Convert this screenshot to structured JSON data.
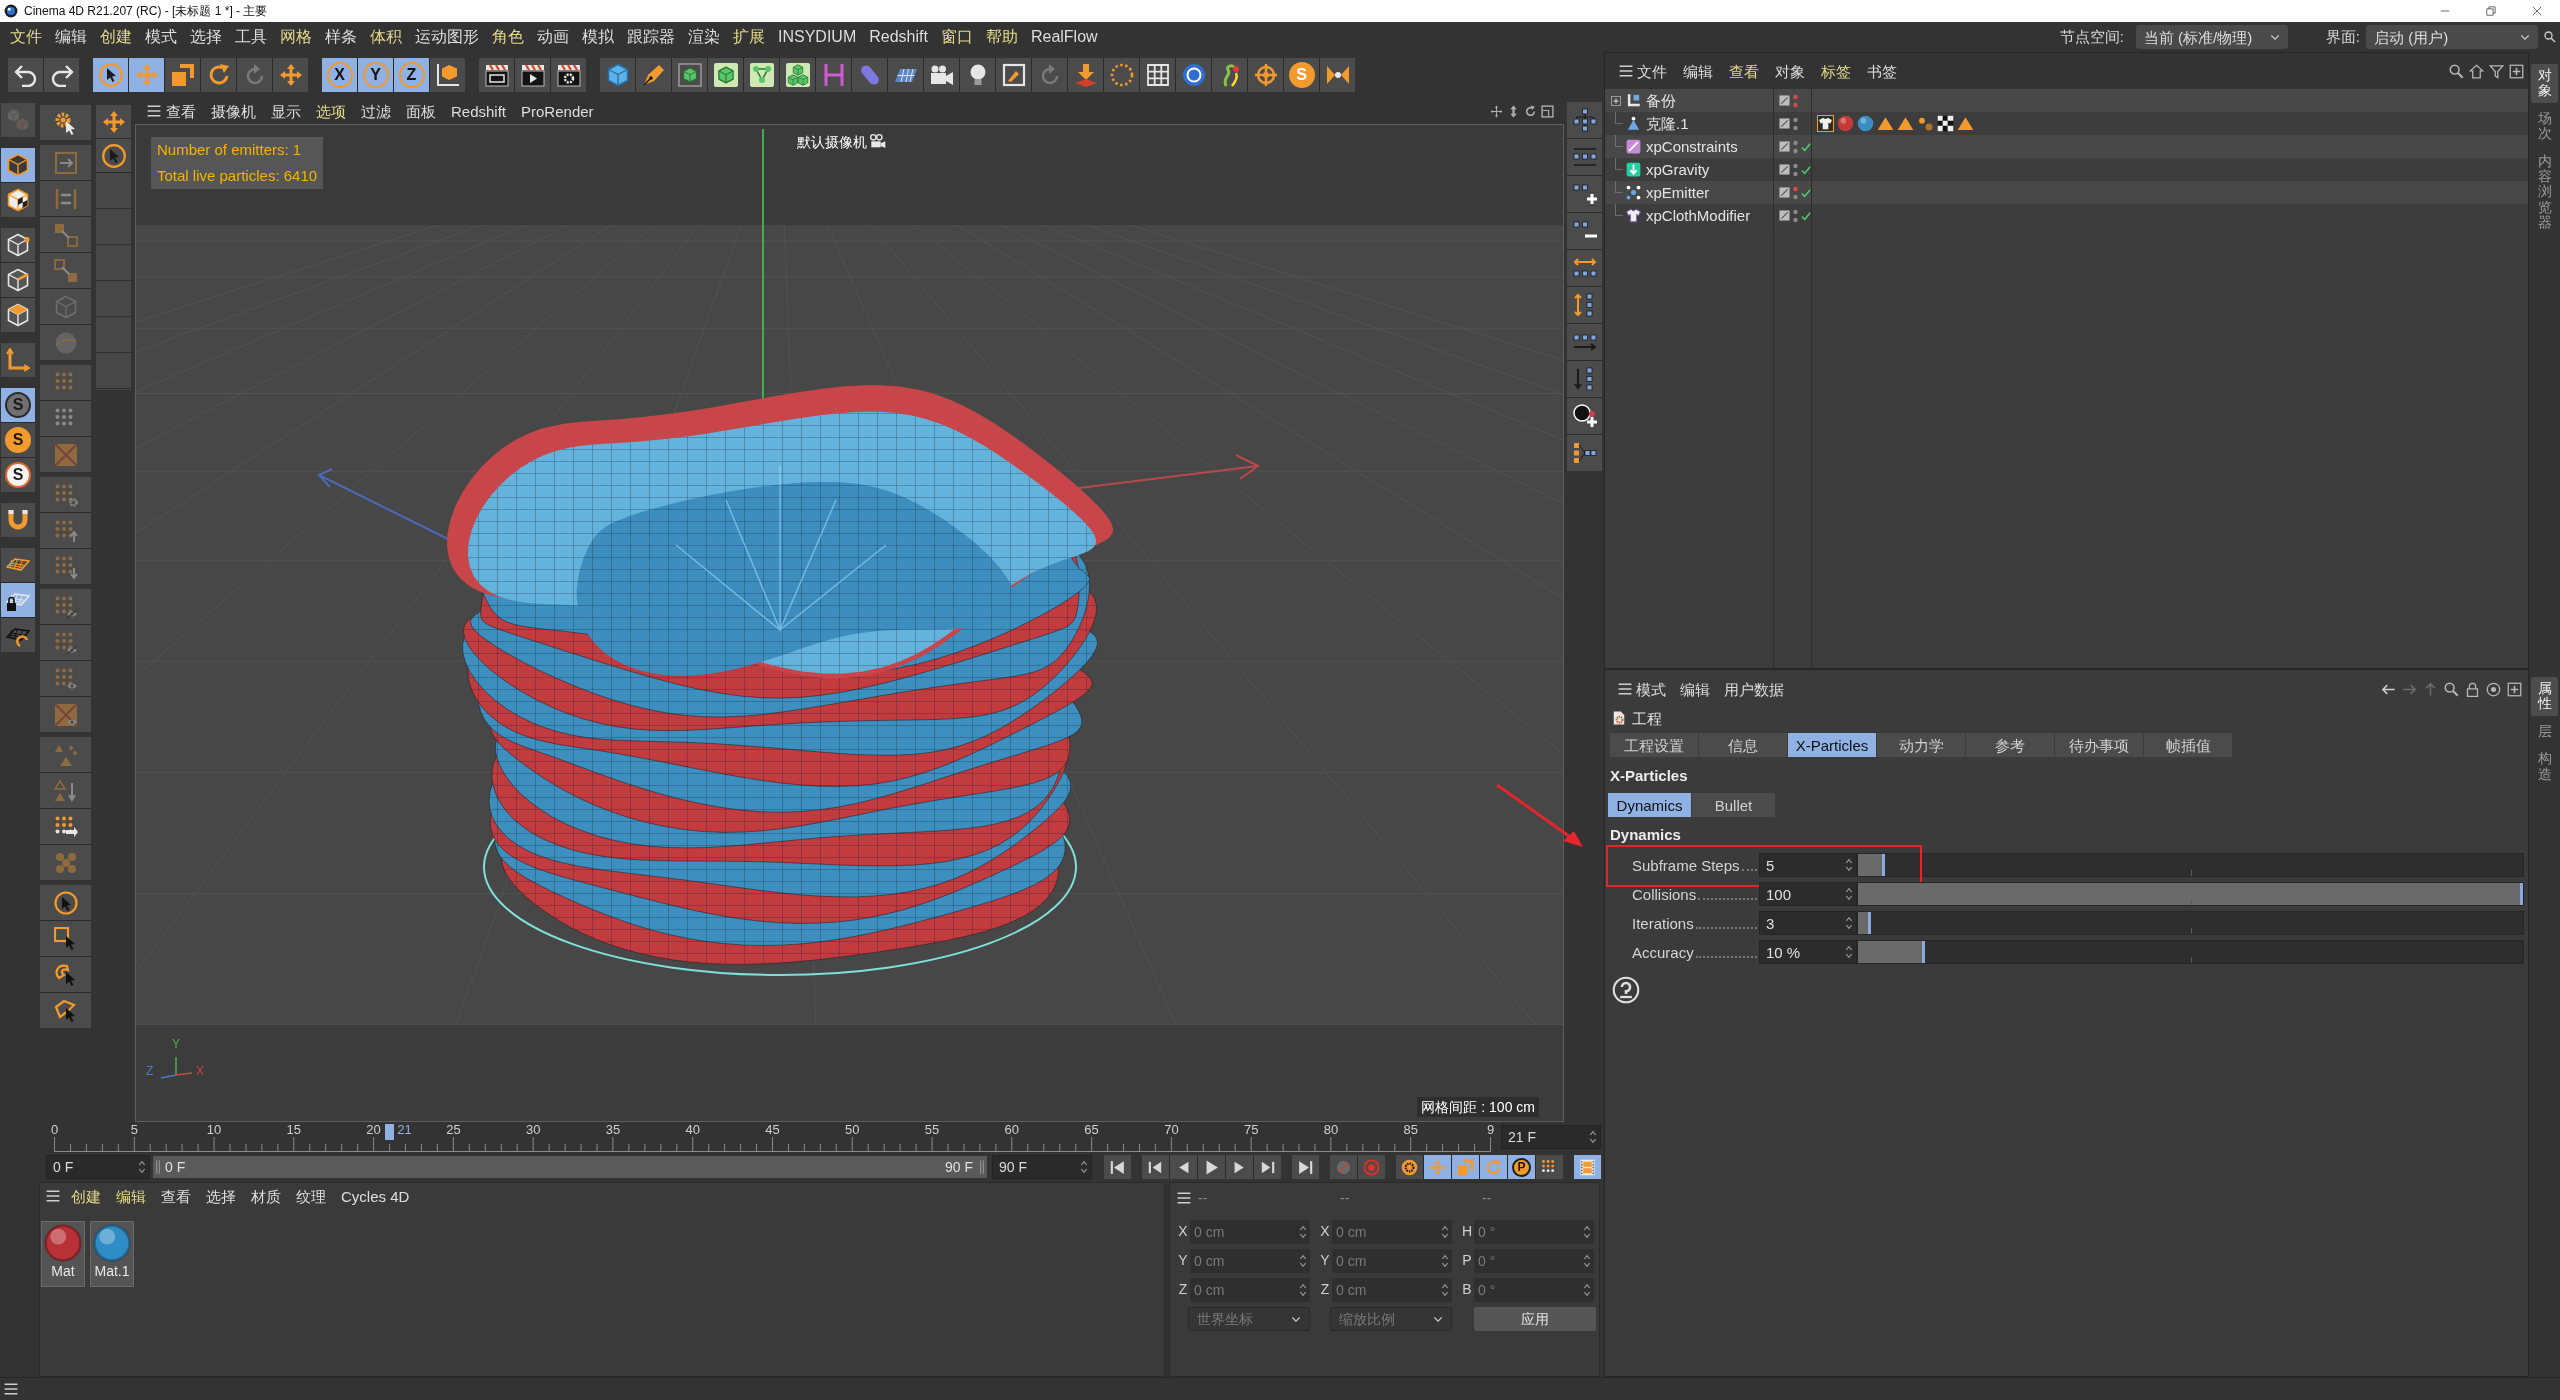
{
  "window": {
    "title": "Cinema 4D R21.207 (RC) - [未标题 1 *] - 主要"
  },
  "menu_bar": {
    "items": [
      {
        "label": "文件",
        "highlighted": true
      },
      {
        "label": "编辑",
        "highlighted": false
      },
      {
        "label": "创建",
        "highlighted": true
      },
      {
        "label": "模式",
        "highlighted": false
      },
      {
        "label": "选择",
        "highlighted": false
      },
      {
        "label": "工具",
        "highlighted": false
      },
      {
        "label": "网格",
        "highlighted": true
      },
      {
        "label": "样条",
        "highlighted": false
      },
      {
        "label": "体积",
        "highlighted": true
      },
      {
        "label": "运动图形",
        "highlighted": false
      },
      {
        "label": "角色",
        "highlighted": true
      },
      {
        "label": "动画",
        "highlighted": false
      },
      {
        "label": "模拟",
        "highlighted": false
      },
      {
        "label": "跟踪器",
        "highlighted": false
      },
      {
        "label": "渲染",
        "highlighted": false
      },
      {
        "label": "扩展",
        "highlighted": true
      },
      {
        "label": "INSYDIUM",
        "highlighted": false
      },
      {
        "label": "Redshift",
        "highlighted": false
      },
      {
        "label": "窗口",
        "highlighted": true
      },
      {
        "label": "帮助",
        "highlighted": true
      },
      {
        "label": "RealFlow",
        "highlighted": false
      }
    ],
    "node_space": {
      "label": "节点空间:",
      "value": "当前 (标准/物理)"
    },
    "layout": {
      "label": "界面:",
      "value": "启动 (用户)"
    }
  },
  "toolbar": {
    "groups": [
      [
        {
          "kind": "undo",
          "selected": false
        },
        {
          "kind": "redo",
          "selected": false
        }
      ],
      [
        {
          "kind": "select",
          "selected": true
        },
        {
          "kind": "move",
          "selected": true
        },
        {
          "kind": "scale",
          "selected": false
        },
        {
          "kind": "rotate",
          "selected": false
        },
        {
          "kind": "reset",
          "selected": false
        },
        {
          "kind": "move_plain",
          "selected": false
        }
      ],
      [
        {
          "kind": "axis",
          "label": "X",
          "selected": true
        },
        {
          "kind": "axis",
          "label": "Y",
          "selected": true
        },
        {
          "kind": "axis",
          "label": "Z",
          "selected": true
        },
        {
          "kind": "coord",
          "selected": false
        }
      ],
      [
        {
          "kind": "render_view",
          "selected": false
        },
        {
          "kind": "render",
          "selected": false
        },
        {
          "kind": "render_settings",
          "selected": false
        }
      ],
      [
        {
          "kind": "cube",
          "selected": false
        },
        {
          "kind": "pen",
          "selected": false
        },
        {
          "kind": "subdiv",
          "selected": false
        },
        {
          "kind": "generator",
          "selected": false
        },
        {
          "kind": "cloner",
          "selected": false
        },
        {
          "kind": "cubes",
          "selected": false
        },
        {
          "kind": "bracket",
          "selected": false
        },
        {
          "kind": "capsule",
          "selected": false
        },
        {
          "kind": "floor",
          "selected": false
        },
        {
          "kind": "camera",
          "selected": false
        },
        {
          "kind": "light",
          "selected": false
        },
        {
          "kind": "frame",
          "selected": false
        },
        {
          "kind": "reset",
          "selected": false
        },
        {
          "kind": "drop",
          "selected": false
        },
        {
          "kind": "dotted",
          "selected": false
        },
        {
          "kind": "grid",
          "selected": false
        },
        {
          "kind": "badge",
          "selected": false
        },
        {
          "kind": "sprout",
          "selected": false
        },
        {
          "kind": "crosshair",
          "selected": false
        },
        {
          "kind": "badge_orange",
          "label": "S",
          "selected": false
        },
        {
          "kind": "arrows_in",
          "selected": false
        }
      ]
    ]
  },
  "left_toolbar": {
    "column_1": [
      [
        {
          "kind": "editable",
          "selected": false,
          "disabled": true
        }
      ],
      [
        {
          "kind": "model",
          "selected": true,
          "disabled": false
        },
        {
          "kind": "texture",
          "selected": false,
          "disabled": false
        }
      ],
      [
        {
          "kind": "point",
          "selected": false,
          "disabled": false
        },
        {
          "kind": "edge",
          "selected": false,
          "disabled": false
        },
        {
          "kind": "poly",
          "selected": false,
          "disabled": false
        }
      ],
      [
        {
          "kind": "axis_mode",
          "selected": false,
          "disabled": false
        }
      ],
      [
        {
          "kind": "snap_gray",
          "label": "S",
          "selected": true,
          "disabled": false
        },
        {
          "kind": "snap_orange",
          "label": "S",
          "selected": false,
          "disabled": false
        },
        {
          "kind": "snap_ring",
          "label": "S",
          "selected": false,
          "disabled": false
        }
      ],
      [
        {
          "kind": "magnet",
          "selected": false,
          "disabled": false
        }
      ],
      [
        {
          "kind": "plane",
          "selected": false,
          "disabled": false
        },
        {
          "kind": "plane_lock",
          "selected": true,
          "disabled": false
        },
        {
          "kind": "plane_rotate",
          "selected": false,
          "disabled": false
        }
      ]
    ],
    "column_2": [
      [
        {
          "kind": "gear_cursor",
          "disabled": false
        }
      ],
      [
        {
          "kind": "box_arrows",
          "disabled": true
        },
        {
          "kind": "bracket_arrows",
          "disabled": true
        },
        {
          "kind": "box_to_box",
          "disabled": true
        },
        {
          "kind": "box_from_box",
          "disabled": true
        },
        {
          "kind": "wire_cube",
          "disabled": true
        },
        {
          "kind": "wire_sphere",
          "disabled": true
        }
      ],
      [
        {
          "kind": "dots_orange",
          "disabled": true
        },
        {
          "kind": "dots",
          "disabled": true
        },
        {
          "kind": "square_cross",
          "disabled": true
        }
      ],
      [
        {
          "kind": "dots_gear",
          "disabled": true
        },
        {
          "kind": "dots_up",
          "disabled": true
        },
        {
          "kind": "dots_down",
          "disabled": true
        }
      ],
      [
        {
          "kind": "dots_eye_off",
          "disabled": true
        },
        {
          "kind": "dots_eye_off",
          "disabled": true
        },
        {
          "kind": "dots_eye",
          "disabled": true
        },
        {
          "kind": "square_eye",
          "disabled": true
        }
      ],
      [
        {
          "kind": "triangles",
          "disabled": true
        },
        {
          "kind": "triangle_down",
          "disabled": true
        },
        {
          "kind": "dots_arrow",
          "disabled": false
        },
        {
          "kind": "hex_dots",
          "disabled": true
        }
      ],
      [
        {
          "kind": "circle_cursor",
          "disabled": false
        },
        {
          "kind": "rect_cursor",
          "disabled": false
        },
        {
          "kind": "lasso_cursor",
          "disabled": false
        },
        {
          "kind": "poly_cursor",
          "disabled": false
        }
      ]
    ],
    "column_3": [
      {
        "kind": "move"
      },
      {
        "kind": "select"
      }
    ]
  },
  "viewport": {
    "menu": [
      {
        "label": "查看",
        "highlighted": false
      },
      {
        "label": "摄像机",
        "highlighted": false
      },
      {
        "label": "显示",
        "highlighted": false
      },
      {
        "label": "选项",
        "highlighted": true
      },
      {
        "label": "过滤",
        "highlighted": false
      },
      {
        "label": "面板",
        "highlighted": false
      },
      {
        "label": "Redshift",
        "highlighted": false
      },
      {
        "label": "ProRender",
        "highlighted": false
      }
    ],
    "hud": [
      "Number of emitters: 1",
      "Total live particles: 6410"
    ],
    "camera": "默认摄像机",
    "grid_spacing": "网格间距 : 100 cm",
    "axis_gizmo": [
      {
        "label": "Y",
        "color": "#4caf50"
      },
      {
        "label": "Z",
        "color": "#4a78d0"
      },
      {
        "label": "X",
        "color": "#d04545"
      }
    ]
  },
  "object_manager": {
    "menu": [
      {
        "label": "文件",
        "highlighted": false
      },
      {
        "label": "编辑",
        "highlighted": false
      },
      {
        "label": "查看",
        "highlighted": true
      },
      {
        "label": "对象",
        "highlighted": false
      },
      {
        "label": "标签",
        "highlighted": true
      },
      {
        "label": "书签",
        "highlighted": false
      }
    ],
    "objects": [
      {
        "name": "备份",
        "kind": "null",
        "collapsed": true,
        "editor_hidden": true,
        "render_hidden": true,
        "enabled": false
      },
      {
        "name": "克隆.1",
        "kind": "cloner",
        "collapsed": false,
        "editor_hidden": false,
        "render_hidden": false,
        "enabled": false,
        "tags": [
          {
            "kind": "cloth",
            "selected": true
          },
          {
            "kind": "material",
            "color": "#c43a3a",
            "selected": false
          },
          {
            "kind": "material",
            "color": "#3a8ec4",
            "selected": false
          },
          {
            "kind": "triangle",
            "selected": false
          },
          {
            "kind": "triangle",
            "selected": false
          },
          {
            "kind": "particles",
            "selected": false
          },
          {
            "kind": "checker",
            "selected": false
          },
          {
            "kind": "triangle",
            "selected": false
          }
        ]
      },
      {
        "name": "xpConstraints",
        "kind": "constraints",
        "collapsed": false,
        "editor_hidden": false,
        "render_hidden": false,
        "enabled": true
      },
      {
        "name": "xpGravity",
        "kind": "gravity",
        "collapsed": false,
        "editor_hidden": false,
        "render_hidden": false,
        "enabled": true
      },
      {
        "name": "xpEmitter",
        "kind": "emitter",
        "collapsed": false,
        "editor_hidden": true,
        "render_hidden": false,
        "enabled": true
      },
      {
        "name": "xpClothModifier",
        "kind": "cloth_modifier",
        "collapsed": false,
        "editor_hidden": false,
        "render_hidden": false,
        "enabled": true
      }
    ]
  },
  "attribute_manager": {
    "menu": [
      "模式",
      "编辑",
      "用户数据"
    ],
    "title": "工程",
    "tabs": [
      {
        "label": "工程设置",
        "selected": false
      },
      {
        "label": "信息",
        "selected": false
      },
      {
        "label": "X-Particles",
        "selected": true
      },
      {
        "label": "动力学",
        "selected": false
      },
      {
        "label": "参考",
        "selected": false
      },
      {
        "label": "待办事项",
        "selected": false
      },
      {
        "label": "帧插值",
        "selected": false
      }
    ],
    "section": "X-Particles",
    "subtabs": [
      {
        "label": "Dynamics",
        "selected": true
      },
      {
        "label": "Bullet",
        "selected": false
      }
    ],
    "group": "Dynamics",
    "params": [
      {
        "label": "Subframe Steps",
        "value": "5",
        "level": 0.04,
        "highlighted": true
      },
      {
        "label": "Collisions",
        "value": "100",
        "level": 1,
        "highlighted": false
      },
      {
        "label": "Iterations",
        "value": "3",
        "level": 0.02,
        "highlighted": false
      },
      {
        "label": "Accuracy",
        "value": "10 %",
        "level": 0.1,
        "highlighted": false
      }
    ]
  },
  "side_tabs": {
    "top": [
      {
        "label": "对象",
        "selected": true
      },
      {
        "label": "场次",
        "selected": false
      },
      {
        "label": "内容浏览器",
        "selected": false
      }
    ],
    "bottom": [
      {
        "label": "属性",
        "selected": true
      },
      {
        "label": "层",
        "selected": false
      },
      {
        "label": "构造",
        "selected": false
      }
    ]
  },
  "timeline": {
    "ticks": [
      "0",
      "5",
      "10",
      "15",
      "20",
      "25",
      "30",
      "35",
      "40",
      "45",
      "50",
      "55",
      "60",
      "65",
      "70",
      "75",
      "80",
      "85",
      "9"
    ],
    "playhead": {
      "label": "21",
      "level": 0.2333
    },
    "current_frame": "21 F",
    "start": "0 F",
    "range": {
      "start": "0 F",
      "end": "90 F",
      "level": 1
    },
    "end": "90 F",
    "controls": [
      [
        {
          "kind": "first",
          "selected": false
        }
      ],
      [
        {
          "kind": "prev_key",
          "selected": false
        },
        {
          "kind": "prev_frame",
          "selected": false
        },
        {
          "kind": "play",
          "selected": false
        },
        {
          "kind": "next_frame",
          "selected": false
        },
        {
          "kind": "next_key",
          "selected": false
        }
      ],
      [
        {
          "kind": "last",
          "selected": false
        }
      ],
      [
        {
          "kind": "record",
          "selected": false
        },
        {
          "kind": "autokey",
          "selected": false
        }
      ],
      [
        {
          "kind": "keyframe",
          "selected": false
        },
        {
          "kind": "move",
          "selected": true
        },
        {
          "kind": "scale",
          "selected": true
        },
        {
          "kind": "rotate",
          "selected": true
        },
        {
          "kind": "param",
          "label": "P",
          "selected": true
        },
        {
          "kind": "key_pla",
          "selected": false
        }
      ],
      [
        {
          "kind": "film",
          "selected": true
        }
      ]
    ]
  },
  "materials": {
    "menu": [
      {
        "label": "创建",
        "highlighted": true
      },
      {
        "label": "编辑",
        "highlighted": true
      },
      {
        "label": "查看",
        "highlighted": false
      },
      {
        "label": "选择",
        "highlighted": false
      },
      {
        "label": "材质",
        "highlighted": false
      },
      {
        "label": "纹理",
        "highlighted": false
      },
      {
        "label": "Cycles 4D",
        "highlighted": false
      }
    ],
    "items": [
      {
        "name": "Mat",
        "color": "#b83136"
      },
      {
        "name": "Mat.1",
        "color": "#2f8dc6"
      }
    ]
  },
  "coordinates": {
    "headers": [
      "--",
      "--",
      "--"
    ],
    "columns": [
      [
        {
          "axis": "X",
          "value": "0 cm"
        },
        {
          "axis": "Y",
          "value": "0 cm"
        },
        {
          "axis": "Z",
          "value": "0 cm"
        }
      ],
      [
        {
          "axis": "X",
          "value": "0 cm"
        },
        {
          "axis": "Y",
          "value": "0 cm"
        },
        {
          "axis": "Z",
          "value": "0 cm"
        }
      ],
      [
        {
          "axis": "H",
          "value": "0 °"
        },
        {
          "axis": "P",
          "value": "0 °"
        },
        {
          "axis": "B",
          "value": "0 °"
        }
      ]
    ],
    "disabled": true,
    "dropdowns": [
      "世界坐标",
      "缩放比例"
    ],
    "apply": "应用"
  }
}
